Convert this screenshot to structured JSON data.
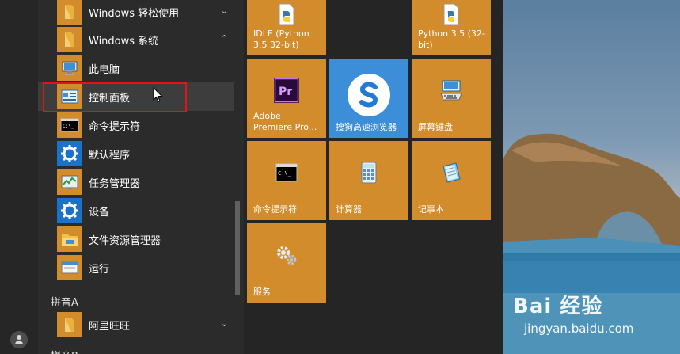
{
  "applist": {
    "items": [
      {
        "label": "Windows 轻松使用",
        "chevron": "⌄"
      },
      {
        "label": "Windows 系统",
        "chevron": "⌃"
      },
      {
        "label": "此电脑"
      },
      {
        "label": "控制面板"
      },
      {
        "label": "命令提示符"
      },
      {
        "label": "默认程序"
      },
      {
        "label": "任务管理器"
      },
      {
        "label": "设备"
      },
      {
        "label": "文件资源管理器"
      },
      {
        "label": "运行"
      },
      {
        "label": "阿里旺旺",
        "chevron": "⌄"
      }
    ],
    "sections": [
      "拼音A",
      "拼音B"
    ]
  },
  "tiles": [
    {
      "label": "IDLE (Python 3.5 32-bit)",
      "icon": "python-file-icon"
    },
    {
      "label": "Python 3.5 (32-bit)",
      "icon": "python-file-icon"
    },
    {
      "label": "Adobe Premiere Pro...",
      "icon": "premiere-icon"
    },
    {
      "label": "搜狗高速浏览器",
      "icon": "sogou-browser-icon"
    },
    {
      "label": "屏幕键盘",
      "icon": "keyboard-icon"
    },
    {
      "label": "命令提示符",
      "icon": "cmd-icon"
    },
    {
      "label": "计算器",
      "icon": "calculator-icon"
    },
    {
      "label": "记事本",
      "icon": "notepad-icon"
    },
    {
      "label": "服务",
      "icon": "gears-icon"
    }
  ],
  "watermark": {
    "logo": "Bai 经验",
    "url": "jingyan.baidu.com"
  },
  "colors": {
    "tile": "#d38c2b",
    "tile_blue": "#3c8ed9",
    "highlight": "#e0151a",
    "folder": "#e9b23c"
  }
}
